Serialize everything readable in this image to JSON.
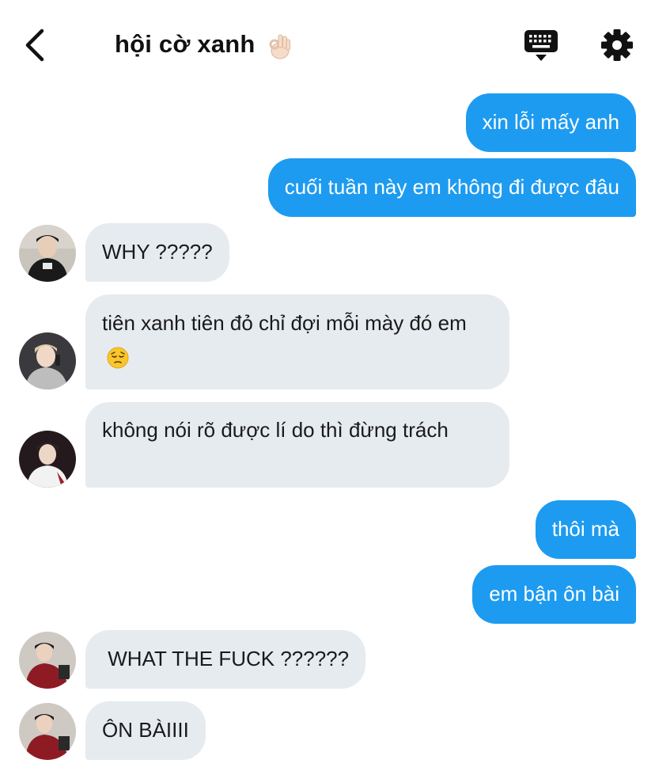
{
  "header": {
    "title": "hội cờ xanh",
    "title_emoji": "ok-hand-emoji",
    "back_icon": "chevron-left-icon",
    "keyboard_icon": "keyboard-icon",
    "settings_icon": "gear-icon"
  },
  "colors": {
    "outgoing_bubble": "#1d9bf0",
    "incoming_bubble": "#e6ebf0",
    "text": "#111111"
  },
  "messages": [
    {
      "side": "out",
      "text": "xin lỗi mấy anh"
    },
    {
      "side": "out",
      "text": "cuối tuần này em không đi được đâu"
    },
    {
      "side": "in",
      "text": "WHY ?????"
    },
    {
      "side": "in",
      "text": "tiên xanh tiên đỏ chỉ đợi mỗi mày đó em",
      "emoji": "pensive-face-emoji"
    },
    {
      "side": "in",
      "text": "không nói rõ được lí do thì đừng trách"
    },
    {
      "side": "out",
      "text": "thôi mà"
    },
    {
      "side": "out",
      "text": "em bận ôn bài"
    },
    {
      "side": "in",
      "text": " WHAT THE FUCK ??????"
    },
    {
      "side": "in",
      "text": "ÔN BÀIIII"
    }
  ]
}
